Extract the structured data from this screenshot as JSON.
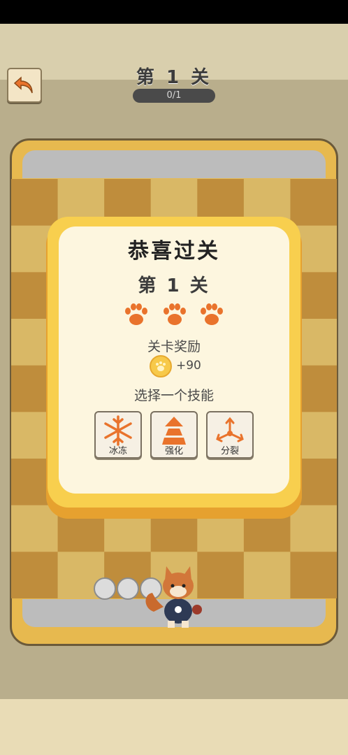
{
  "header": {
    "level_title": "第 1 关",
    "progress_text": "0/1",
    "back_icon": "back-arrow-icon"
  },
  "modal": {
    "heading": "恭喜过关",
    "level_text": "第 1 关",
    "paws_earned": 3,
    "paws_total": 3,
    "reward_label": "关卡奖励",
    "reward_icon": "coin-icon",
    "reward_amount": "+90",
    "choose_label": "选择一个技能",
    "skills": [
      {
        "label": "冰冻",
        "icon": "snowflake-icon"
      },
      {
        "label": "强化",
        "icon": "arrow-up-icon"
      },
      {
        "label": "分裂",
        "icon": "split-arrows-icon"
      }
    ]
  },
  "colors": {
    "accent": "#e9732c",
    "modal_yellow": "#f8cf4e",
    "board_dark": "#bf8d3c",
    "board_light": "#d9b866"
  }
}
